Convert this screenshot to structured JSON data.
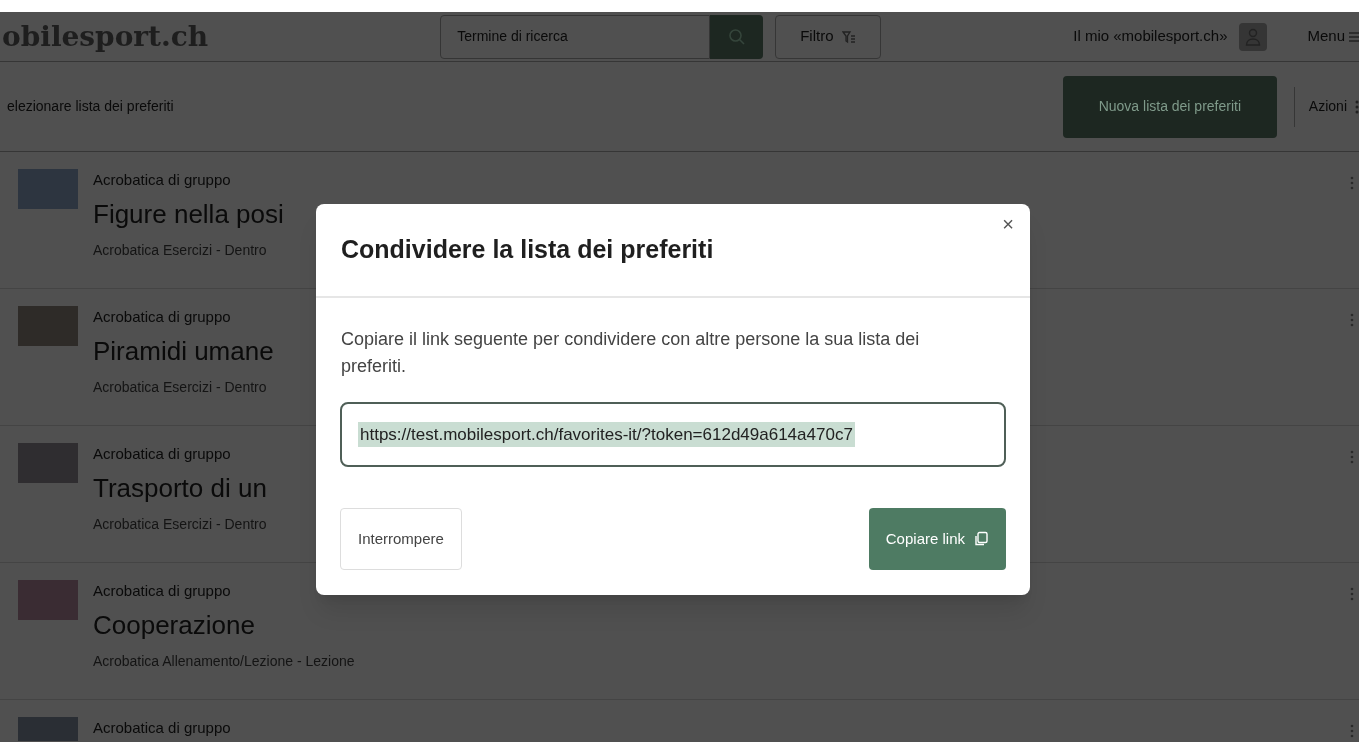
{
  "header": {
    "logo": "obilesport.ch",
    "search_placeholder": "Termine di ricerca",
    "filter": "Filtro",
    "account": "Il mio «mobilesport.ch»",
    "menu": "Menu"
  },
  "toolbar": {
    "select_list": "elezionare lista dei preferiti",
    "new_list": "Nuova lista dei preferiti",
    "actions": "Azioni"
  },
  "items": [
    {
      "category": "Acrobatica di gruppo",
      "title": "Figure nella posi",
      "meta": "Acrobatica Esercizi - Dentro"
    },
    {
      "category": "Acrobatica di gruppo",
      "title": "Piramidi umane",
      "meta": "Acrobatica Esercizi - Dentro"
    },
    {
      "category": "Acrobatica di gruppo",
      "title": "Trasporto di un",
      "meta": "Acrobatica Esercizi - Dentro"
    },
    {
      "category": "Acrobatica di gruppo",
      "title": "Cooperazione",
      "meta": "Acrobatica Allenamento/Lezione - Lezione"
    },
    {
      "category": "Acrobatica di gruppo"
    }
  ],
  "dialog": {
    "title": "Condividere la lista dei preferiti",
    "close": "×",
    "text": "Copiare il link seguente per condividere con altre persone la sua lista dei preferiti.",
    "link": "https://test.mobilesport.ch/favorites-it/?token=612d49a614a470c7",
    "cancel": "Interrompere",
    "copy": "Copiare link"
  }
}
